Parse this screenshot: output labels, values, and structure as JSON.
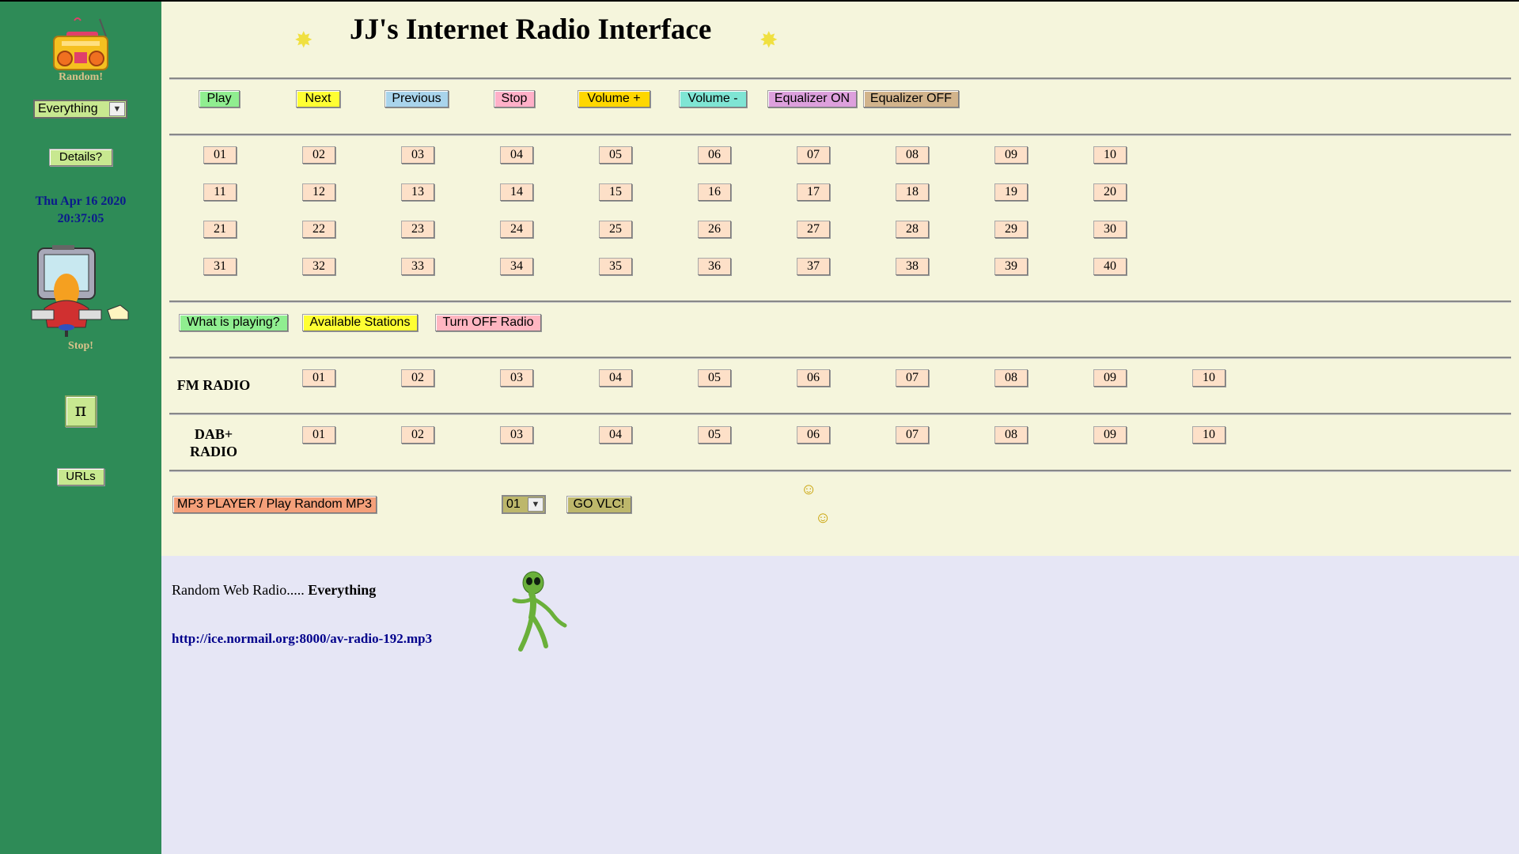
{
  "sidebar": {
    "random_caption": "Random!",
    "category_select": "Everything",
    "details_label": "Details?",
    "date": "Thu Apr 16 2020",
    "time": "20:37:05",
    "stop_caption": "Stop!",
    "pi_label": "π",
    "urls_label": "URLs"
  },
  "header": {
    "title": "JJ's Internet Radio Interface"
  },
  "controls": [
    {
      "label": "Play",
      "color": "#90ee90"
    },
    {
      "label": "Next",
      "color": "#ffff33"
    },
    {
      "label": "Previous",
      "color": "#a9d4ec"
    },
    {
      "label": "Stop",
      "color": "#ffb0c8"
    },
    {
      "label": "Volume +",
      "color": "#ffd700"
    },
    {
      "label": "Volume -",
      "color": "#7fe5d4"
    },
    {
      "label": "Equalizer ON",
      "color": "#dda0dd"
    },
    {
      "label": "Equalizer OFF",
      "color": "#d2b48c"
    }
  ],
  "stations": [
    [
      "01",
      "02",
      "03",
      "04",
      "05",
      "06",
      "07",
      "08",
      "09",
      "10"
    ],
    [
      "11",
      "12",
      "13",
      "14",
      "15",
      "16",
      "17",
      "18",
      "19",
      "20"
    ],
    [
      "21",
      "22",
      "23",
      "24",
      "25",
      "26",
      "27",
      "28",
      "29",
      "30"
    ],
    [
      "31",
      "32",
      "33",
      "34",
      "35",
      "36",
      "37",
      "38",
      "39",
      "40"
    ]
  ],
  "actions": [
    {
      "label": "What is playing?",
      "color": "#90ee90"
    },
    {
      "label": "Available Stations",
      "color": "#ffff33"
    },
    {
      "label": "Turn OFF Radio",
      "color": "#ffb6c1"
    }
  ],
  "fm": {
    "label": "FM RADIO",
    "stations": [
      "01",
      "02",
      "03",
      "04",
      "05",
      "06",
      "07",
      "08",
      "09",
      "10"
    ]
  },
  "dab": {
    "label_line1": "DAB+",
    "label_line2": "RADIO",
    "stations": [
      "01",
      "02",
      "03",
      "04",
      "05",
      "06",
      "07",
      "08",
      "09",
      "10"
    ]
  },
  "mp3": {
    "player_label": "MP3 PLAYER / Play Random MP3",
    "track_select": "01",
    "vlc_label": "GO VLC!",
    "player_color": "#f4a07a",
    "vlc_color": "#bdb76b"
  },
  "nowplaying": {
    "prefix": "Random Web Radio.....",
    "category": "Everything",
    "url": "http://ice.normail.org:8000/av-radio-192.mp3"
  },
  "colors": {
    "sidebar_bg": "#2e8b57",
    "main_bg": "#f5f5dc",
    "lower_bg": "#e6e6f5",
    "number_btn": "#fde0c8",
    "date_color": "#00008b"
  }
}
